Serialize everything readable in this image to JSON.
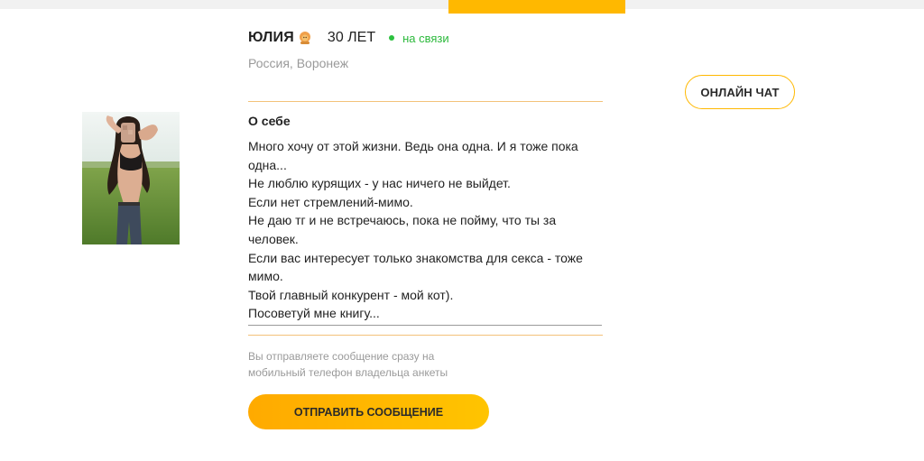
{
  "profile": {
    "name": "ЮЛИЯ",
    "zodiac_icon": "lion-zodiac-icon",
    "age": "30 ЛЕТ",
    "status": "на связи",
    "location": "Россия, Воронеж",
    "photo_icon": "profile-photo"
  },
  "actions": {
    "online_chat": "ОНЛАЙН ЧАТ",
    "send_message": "ОТПРАВИТЬ СООБЩЕНИЕ"
  },
  "about": {
    "title": "О себе",
    "text": "Много хочу от этой жизни. Ведь она одна. И я тоже пока одна...\nНе люблю курящих - у нас ничего не выйдет.\nЕсли нет стремлений-мимо.\nНе даю тг и не встречаюсь, пока не пойму, что ты за человек.\nЕсли вас интересует только знакомства для секса - тоже мимо.\nТвой главный конкурент - мой кот).\nПосоветуй мне книгу..."
  },
  "hint": "Вы отправляете сообщение сразу на мобильный телефон владельца анкеты",
  "colors": {
    "accent": "#ffb800",
    "online": "#2cc13f",
    "muted": "#9a9a9a",
    "divider": "#f3c27a"
  }
}
